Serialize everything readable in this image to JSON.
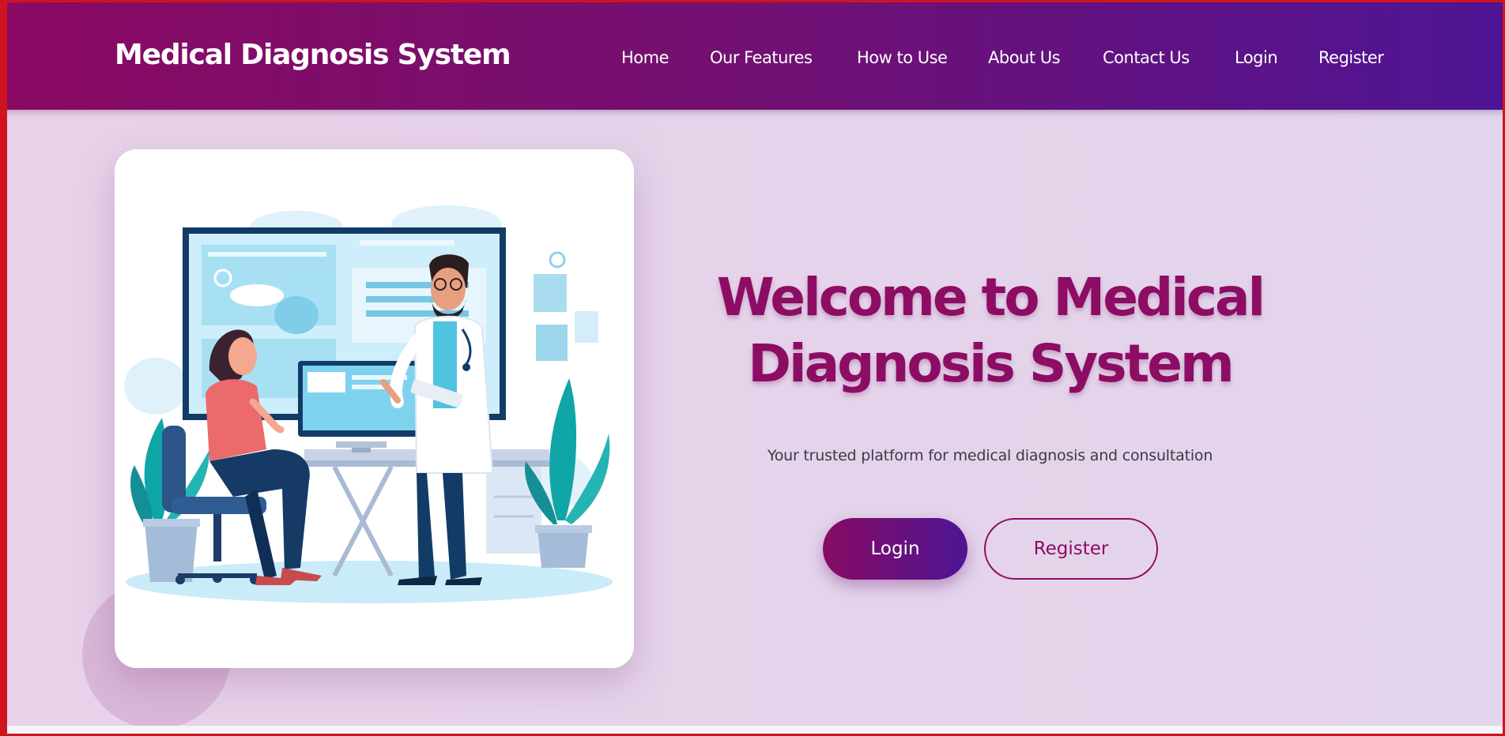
{
  "header": {
    "brand": "Medical Diagnosis System",
    "nav": [
      "Home",
      "Our Features",
      "How to Use",
      "About Us",
      "Contact Us",
      "Login",
      "Register"
    ]
  },
  "hero": {
    "title_line1": "Welcome to Medical",
    "title_line2": "Diagnosis System",
    "subtitle": "Your trusted platform for medical diagnosis and consultation",
    "login_label": "Login",
    "register_label": "Register",
    "illustration": "doctor-patient-consultation-illustration"
  },
  "colors": {
    "brand_magenta": "#8d0c64",
    "brand_purple": "#4e1494",
    "hero_background": "#e4d3ea",
    "frame_red": "#d0141f"
  }
}
